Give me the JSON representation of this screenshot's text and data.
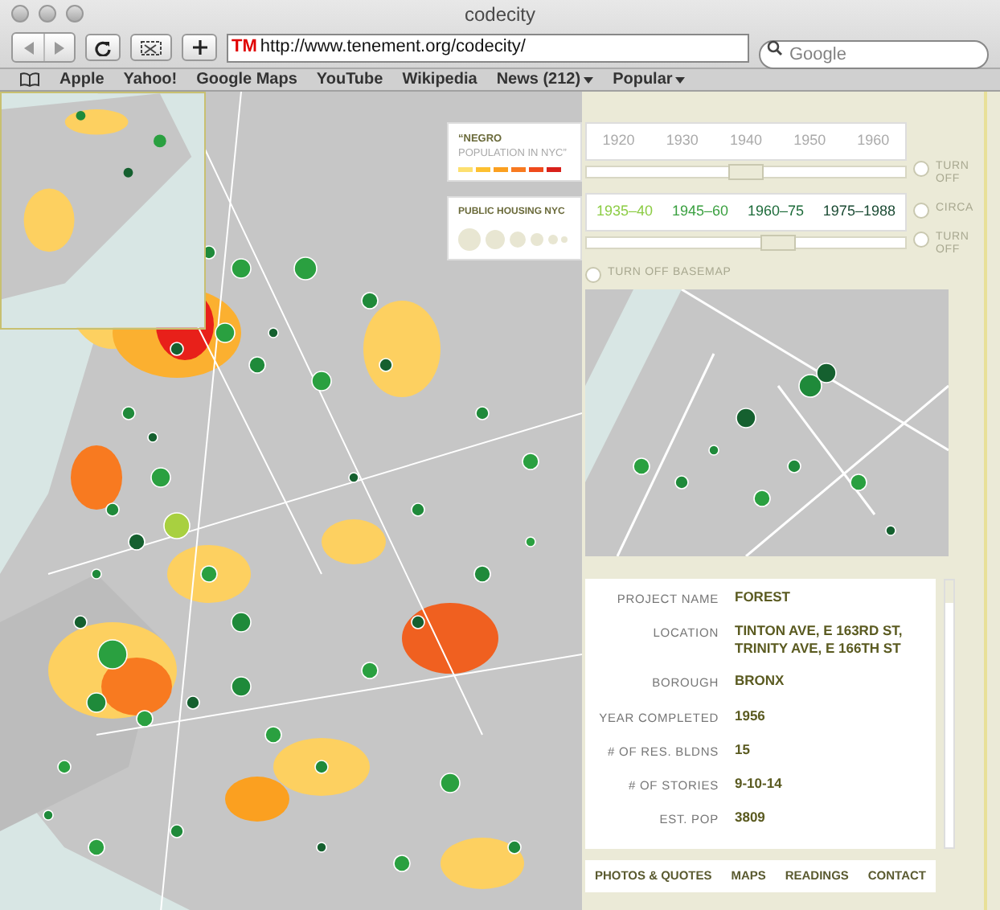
{
  "window": {
    "title": "codecity"
  },
  "toolbar": {
    "url_logo": "TM",
    "url": "http://www.tenement.org/codecity/",
    "search": {
      "placeholder": "Google"
    }
  },
  "bookmarks": [
    {
      "label": "Apple",
      "menu": false
    },
    {
      "label": "Yahoo!",
      "menu": false
    },
    {
      "label": "Google Maps",
      "menu": false
    },
    {
      "label": "YouTube",
      "menu": false
    },
    {
      "label": "Wikipedia",
      "menu": false
    },
    {
      "label": "News (212)",
      "menu": true
    },
    {
      "label": "Popular",
      "menu": true
    }
  ],
  "legend": {
    "population": {
      "title_bold": "“NEGRO",
      "title_rest": "POPULATION IN NYC”",
      "scale": [
        {
          "color": "#fde070"
        },
        {
          "color": "#fdc030"
        },
        {
          "color": "#fba020"
        },
        {
          "color": "#f87a20"
        },
        {
          "color": "#ef4a1c"
        },
        {
          "color": "#d8201a"
        }
      ]
    },
    "housing": {
      "title": "PUBLIC HOUSING NYC"
    }
  },
  "census": {
    "years": [
      "1920",
      "1930",
      "1940",
      "1950",
      "1960"
    ],
    "level": 0.5,
    "toggle": {
      "label": "TURN OFF",
      "selected": false
    }
  },
  "housing_periods": {
    "periods": [
      {
        "label": "1935–40",
        "color": "#8ccc44"
      },
      {
        "label": "1945–60",
        "color": "#3aa040"
      },
      {
        "label": "1960–75",
        "color": "#1d6b3a"
      },
      {
        "label": "1975–1988",
        "color": "#1a4a33"
      }
    ],
    "circa": {
      "label": "CIRCA",
      "selected": false
    },
    "level": 0.6,
    "toggle": {
      "label": "TURN OFF",
      "selected": false
    }
  },
  "basemap_toggle": {
    "label": "TURN OFF BASEMAP",
    "selected": false
  },
  "details": [
    {
      "label": "PROJECT NAME",
      "value": "FOREST"
    },
    {
      "label": "LOCATION",
      "value": "TINTON AVE, E 163RD ST, TRINITY AVE, E 166TH ST"
    },
    {
      "label": "BOROUGH",
      "value": "BRONX"
    },
    {
      "label": "YEAR COMPLETED",
      "value": "1956"
    },
    {
      "label": "# OF RES. BLDNS",
      "value": "15"
    },
    {
      "label": "# OF STORIES",
      "value": "9-10-14"
    },
    {
      "label": "EST. POP",
      "value": "3809"
    }
  ],
  "tabs": [
    "PHOTOS & QUOTES",
    "MAPS",
    "READINGS",
    "CONTACT"
  ]
}
